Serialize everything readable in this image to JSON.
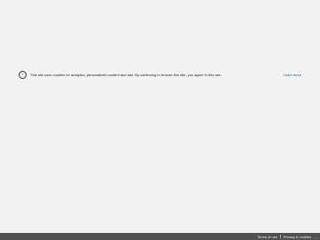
{
  "cookie_banner": {
    "icon": "info-icon",
    "icon_glyph": "i",
    "text": "This site uses cookies for analytics, personalized content and ads. By continuing to browse this site, you agree to this use.",
    "learn_more": "Learn more"
  },
  "footer": {
    "terms": "Terms of use",
    "privacy": "Privacy & cookies",
    "more": "..."
  },
  "colors": {
    "background": "#f2f2f2",
    "footer_bg": "#505050",
    "link": "#1a5aa8"
  }
}
